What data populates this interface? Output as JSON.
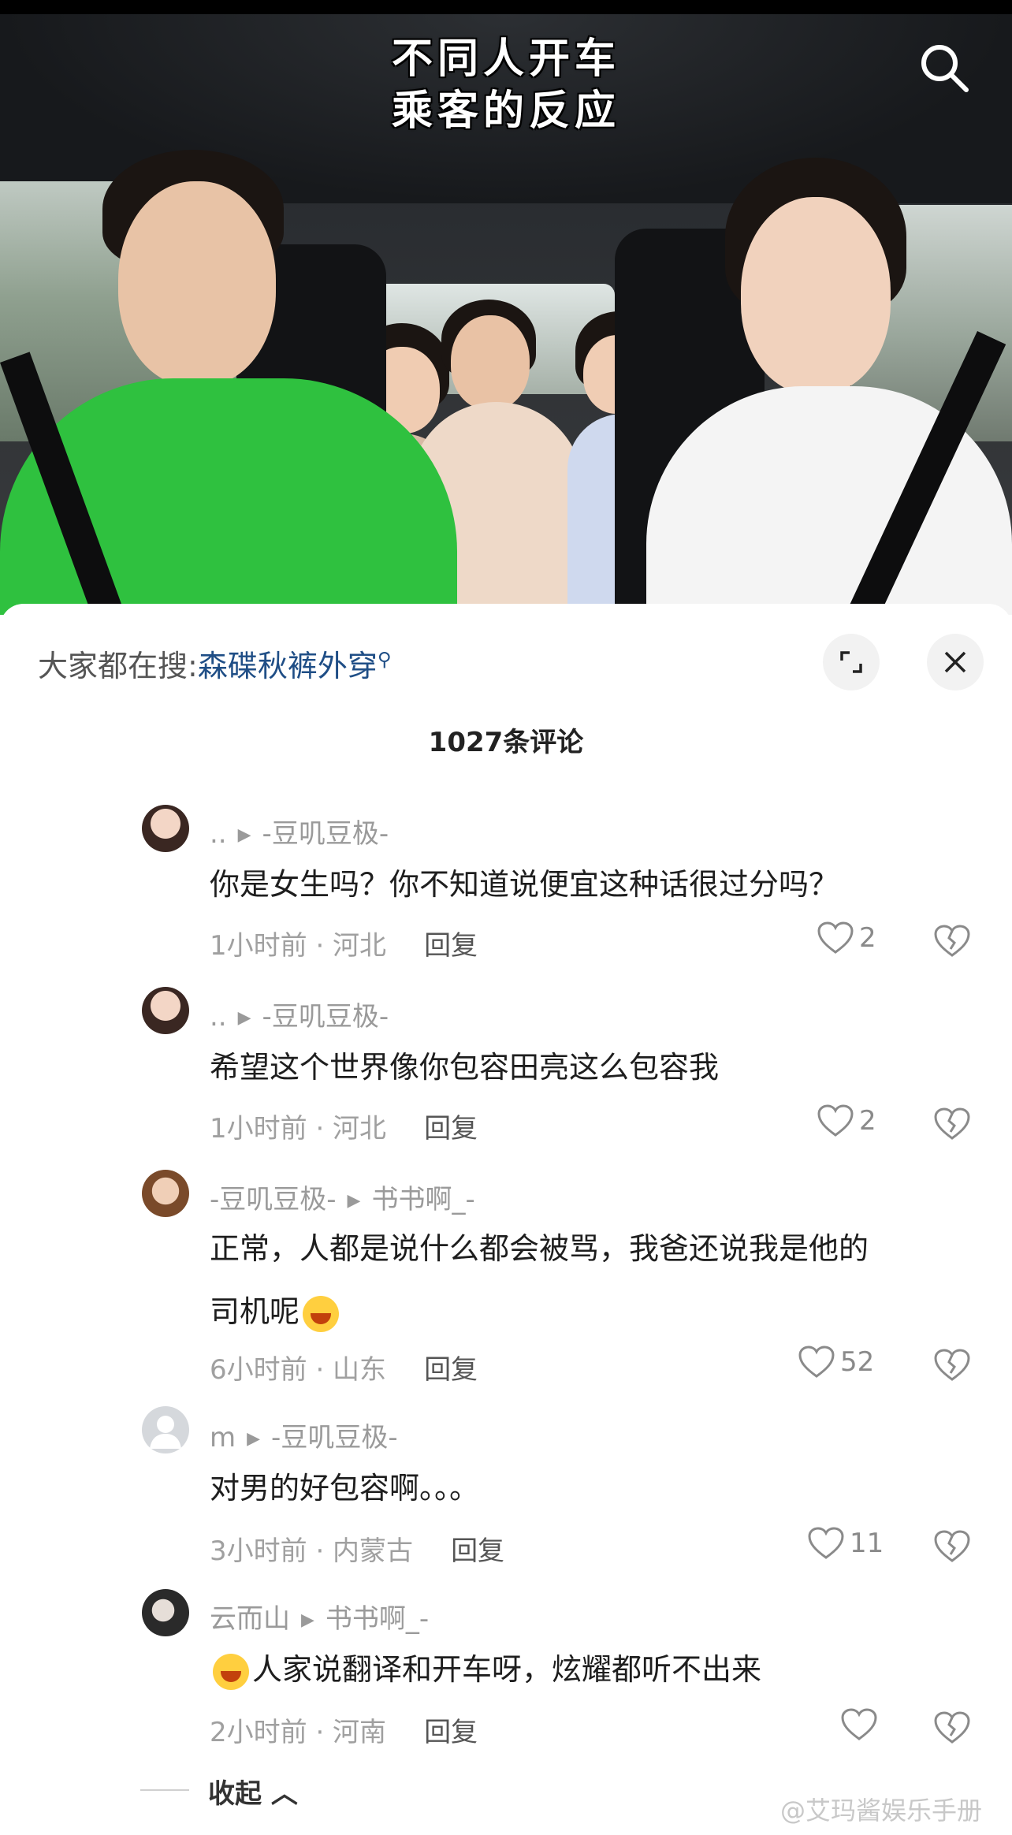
{
  "video": {
    "overlay_title_line1": "不同人开车",
    "overlay_title_line2": "乘客的反应"
  },
  "sheet": {
    "hot_search_prefix": "大家都在搜:",
    "hot_search_keyword": "森碟秋裤外穿",
    "comment_count": "1027条评论",
    "collapse_label": "收起"
  },
  "comments": [
    {
      "user": "..",
      "reply_to": "-豆叽豆极-",
      "text": "你是女生吗？你不知道说便宜这种话很过分吗？",
      "time_location": "1小时前 · 河北",
      "reply_label": "回复",
      "likes": "2"
    },
    {
      "user": "..",
      "reply_to": "-豆叽豆极-",
      "text": "希望这个世界像你包容田亮这么包容我",
      "time_location": "1小时前 · 河北",
      "reply_label": "回复",
      "likes": "2"
    },
    {
      "user": "-豆叽豆极-",
      "reply_to": "书书啊_-",
      "text_line1": "正常，人都是说什么都会被骂，我爸还说我是他的",
      "text_line2": "司机呢",
      "time_location": "6小时前 · 山东",
      "reply_label": "回复",
      "likes": "52"
    },
    {
      "user": "m",
      "reply_to": "-豆叽豆极-",
      "text": "对男的好包容啊。。。",
      "time_location": "3小时前 · 内蒙古",
      "reply_label": "回复",
      "likes": "11"
    },
    {
      "user": "云而山",
      "reply_to": "书书啊_-",
      "text": "人家说翻译和开车呀，炫耀都听不出来",
      "time_location": "2小时前 · 河南",
      "reply_label": "回复",
      "likes": ""
    }
  ],
  "watermark": "@艾玛酱娱乐手册",
  "colors": {
    "keyword": "#1f4e86",
    "meta_gray": "#9a9a9a",
    "green_shirt": "#2fc13f"
  }
}
